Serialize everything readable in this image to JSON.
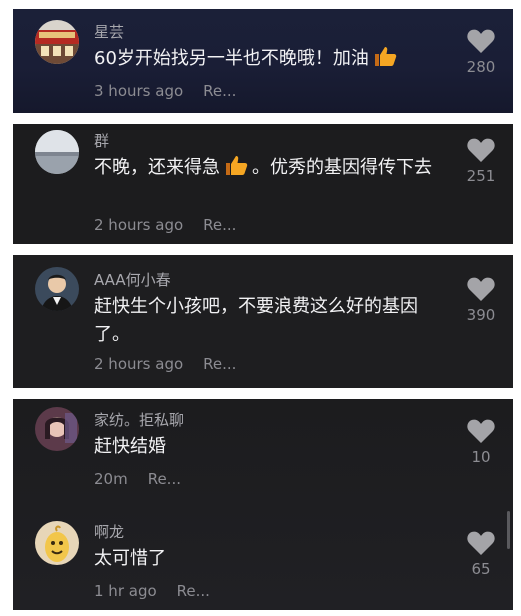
{
  "comments": [
    {
      "username": "星芸",
      "text_before": "60岁开始找另一半也不晚哦！加油",
      "text_after": "",
      "time": "3 hours ago",
      "reply": "Re...",
      "likes": "280"
    },
    {
      "username": "群",
      "text_before": "不晚，还来得急",
      "text_after": "。优秀的基因得传下去",
      "time": "2 hours ago",
      "reply": "Re...",
      "likes": "251"
    },
    {
      "username": "AAA何小春",
      "text_before": "赶快生个小孩吧，不要浪费这么好的基因了。",
      "text_after": "",
      "time": "2 hours ago",
      "reply": "Re...",
      "likes": "390"
    },
    {
      "username": "家纺。拒私聊",
      "text_before": "赶快结婚",
      "text_after": "",
      "time": "20m",
      "reply": "Re...",
      "likes": "10"
    },
    {
      "username": "啊龙",
      "text_before": "太可惜了",
      "text_after": "",
      "time": "1 hr ago",
      "reply": "Re...",
      "likes": "65"
    }
  ],
  "icons": {
    "like": "heart-icon",
    "emoji": "thumbs-up-emoji"
  },
  "colors": {
    "panel_bg": "#1c1c1e",
    "text": "#f2f2f4",
    "meta": "#8c8c92",
    "emoji": "#f5a623"
  }
}
